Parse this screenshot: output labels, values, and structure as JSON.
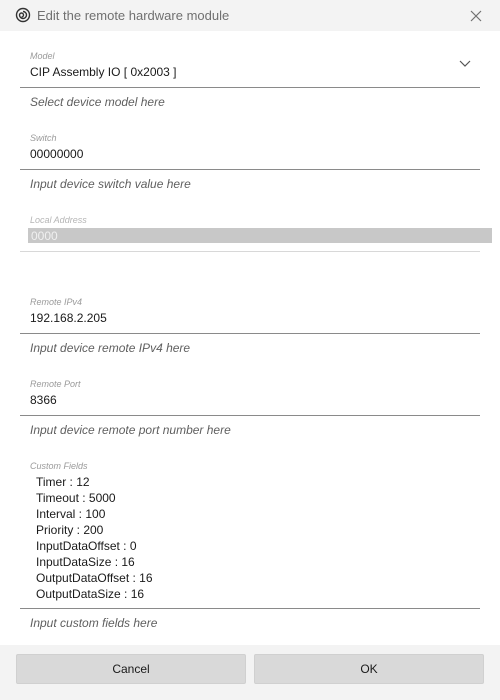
{
  "window": {
    "title": "Edit the remote hardware module",
    "app_icon": "spiral-icon",
    "close_icon": "close-icon"
  },
  "model": {
    "label": "Model",
    "value": "CIP Assembly IO [ 0x2003 ]",
    "hint": "Select device model here",
    "dropdown_icon": "chevron-down-icon"
  },
  "switch": {
    "label": "Switch",
    "value": "00000000",
    "hint": "Input device switch value here"
  },
  "local_address": {
    "label": "Local Address",
    "value": "0000",
    "disabled": true
  },
  "remote_ipv4": {
    "label": "Remote IPv4",
    "value": "192.168.2.205",
    "hint": "Input device remote IPv4 here"
  },
  "remote_port": {
    "label": "Remote Port",
    "value": "8366",
    "hint": "Input device remote port number here"
  },
  "custom_fields": {
    "label": "Custom Fields",
    "items": [
      "Timer : 12",
      "Timeout : 5000",
      "Interval : 100",
      "Priority : 200",
      "InputDataOffset : 0",
      "InputDataSize : 16",
      "OutputDataOffset : 16",
      "OutputDataSize : 16"
    ],
    "hint": "Input custom fields here"
  },
  "buttons": {
    "cancel": "Cancel",
    "ok": "OK"
  }
}
